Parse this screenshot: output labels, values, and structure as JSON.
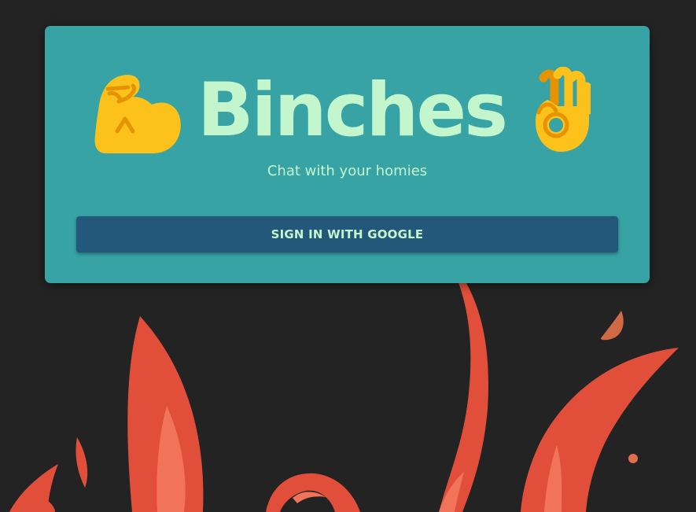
{
  "app": {
    "title": "Binches",
    "subtitle": "Chat with your homies"
  },
  "auth": {
    "signin_label": "SIGN IN WITH GOOGLE"
  },
  "icons": {
    "left": "flexed-biceps-icon",
    "right": "ok-hand-icon"
  },
  "colors": {
    "page_background": "#232323",
    "card_background": "#37a3a5",
    "title_text": "#c3f6cd",
    "button_background": "#23587a",
    "emoji_yellow": "#fcc21b",
    "emoji_shade": "#e59400",
    "flame_red": "#e14f3a",
    "flame_light": "#f0735a"
  }
}
